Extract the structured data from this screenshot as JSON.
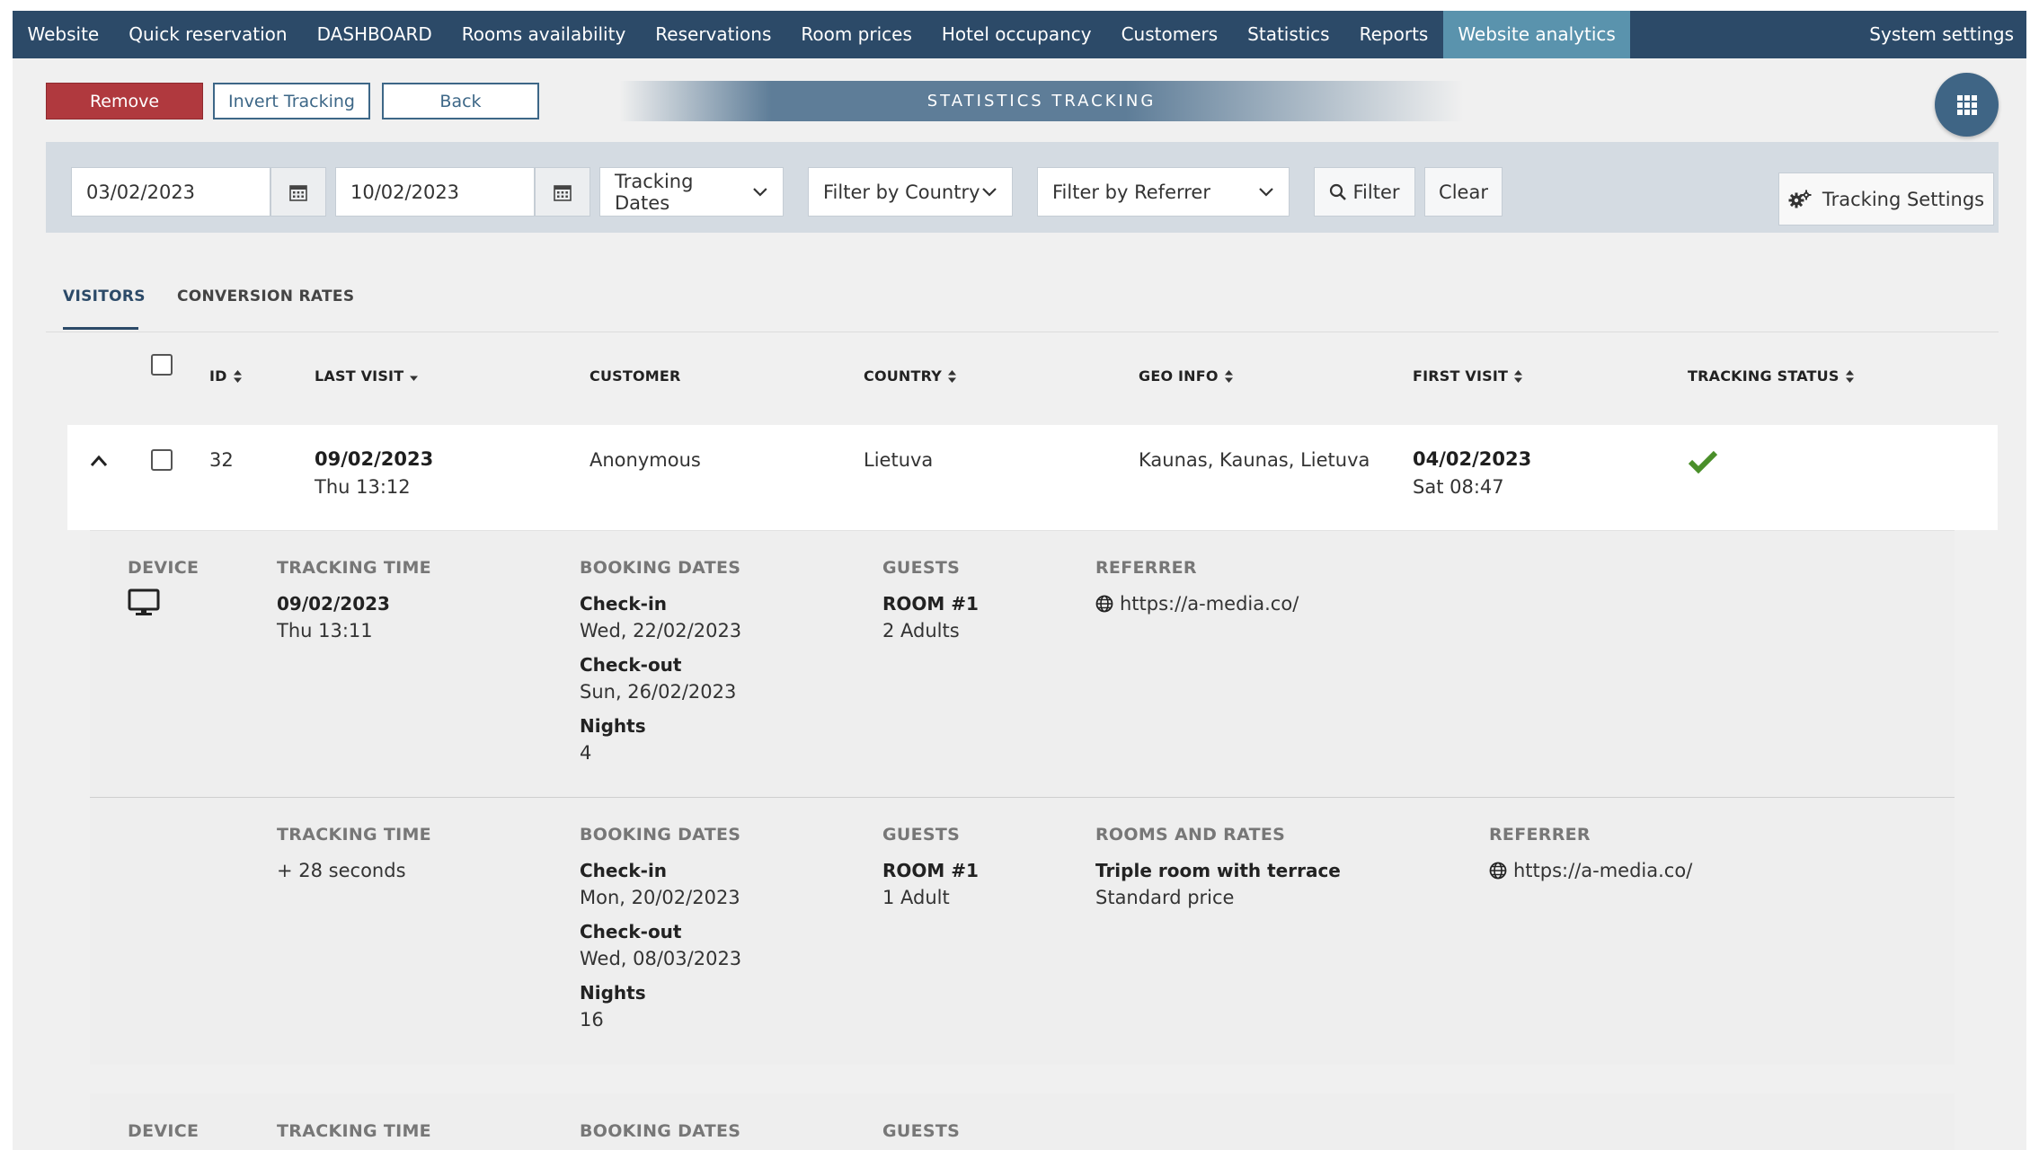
{
  "nav": {
    "items": [
      "Website",
      "Quick reservation",
      "DASHBOARD",
      "Rooms availability",
      "Reservations",
      "Room prices",
      "Hotel occupancy",
      "Customers",
      "Statistics",
      "Reports",
      "Website analytics"
    ],
    "active": "Website analytics",
    "right": "System settings"
  },
  "toolbar": {
    "remove": "Remove",
    "invert": "Invert Tracking",
    "back": "Back",
    "banner": "STATISTICS TRACKING"
  },
  "filters": {
    "date_from": "03/02/2023",
    "date_to": "10/02/2023",
    "date_type": "Tracking Dates",
    "country": "Filter by Country",
    "referrer": "Filter by Referrer",
    "filter_btn": "Filter",
    "clear_btn": "Clear",
    "settings_btn": "Tracking Settings"
  },
  "tabs": {
    "visitors": "VISITORS",
    "conversion": "CONVERSION RATES"
  },
  "columns": {
    "id": "ID",
    "last_visit": "LAST VISIT",
    "customer": "CUSTOMER",
    "country": "COUNTRY",
    "geo": "GEO INFO",
    "first_visit": "FIRST VISIT",
    "status": "TRACKING STATUS"
  },
  "row": {
    "id": "32",
    "last_visit_date": "09/02/2023",
    "last_visit_time": "Thu 13:12",
    "customer": "Anonymous",
    "country": "Lietuva",
    "geo": "Kaunas, Kaunas, Lietuva",
    "first_visit_date": "04/02/2023",
    "first_visit_time": "Sat 08:47",
    "status_color": "#4a8f2a"
  },
  "labels": {
    "device": "DEVICE",
    "tracking_time": "TRACKING TIME",
    "booking_dates": "BOOKING DATES",
    "guests": "GUESTS",
    "referrer": "REFERRER",
    "rooms_rates": "ROOMS AND RATES",
    "check_in": "Check-in",
    "check_out": "Check-out",
    "nights": "Nights"
  },
  "details": [
    {
      "tracking_date": "09/02/2023",
      "tracking_time": "Thu 13:11",
      "check_in": "Wed, 22/02/2023",
      "check_out": "Sun, 26/02/2023",
      "nights": "4",
      "room": "ROOM #1",
      "guests": "2 Adults",
      "referrer": "https://a-media.co/"
    },
    {
      "tracking_time": "+ 28 seconds",
      "check_in": "Mon, 20/02/2023",
      "check_out": "Wed, 08/03/2023",
      "nights": "16",
      "room": "ROOM #1",
      "guests": "1 Adult",
      "room_name": "Triple room with terrace",
      "rate": "Standard price",
      "referrer": "https://a-media.co/"
    }
  ]
}
